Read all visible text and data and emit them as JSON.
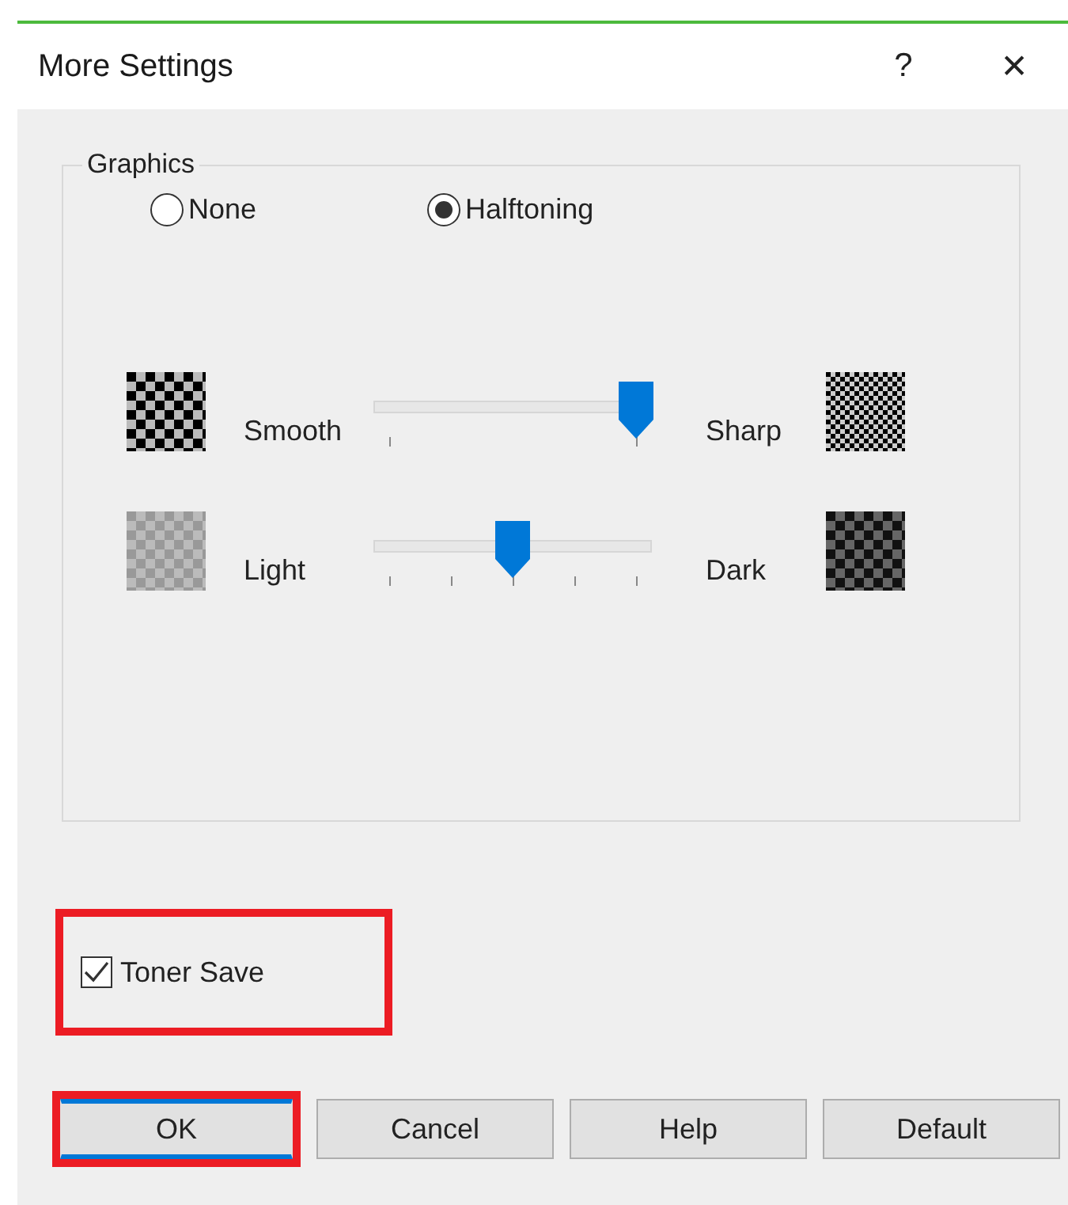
{
  "window": {
    "title": "More Settings",
    "help_glyph": "?",
    "close_glyph": "✕"
  },
  "graphics": {
    "title": "Graphics",
    "radios": [
      {
        "label": "None",
        "selected": false
      },
      {
        "label": "Halftoning",
        "selected": true
      }
    ],
    "sliders": [
      {
        "kind": "two-step",
        "left_label": "Smooth",
        "right_label": "Sharp",
        "level": 1
      },
      {
        "kind": "five-step",
        "left_label": "Light",
        "right_label": "Dark",
        "level": 0.5
      }
    ]
  },
  "toner_save": {
    "label": "Toner Save",
    "checked": true,
    "highlighted": true
  },
  "buttons": [
    {
      "label": "OK",
      "default": true,
      "highlighted": true
    },
    {
      "label": "Cancel",
      "default": false,
      "highlighted": false
    },
    {
      "label": "Help",
      "default": false,
      "highlighted": false
    },
    {
      "label": "Default",
      "default": false,
      "highlighted": false
    }
  ]
}
